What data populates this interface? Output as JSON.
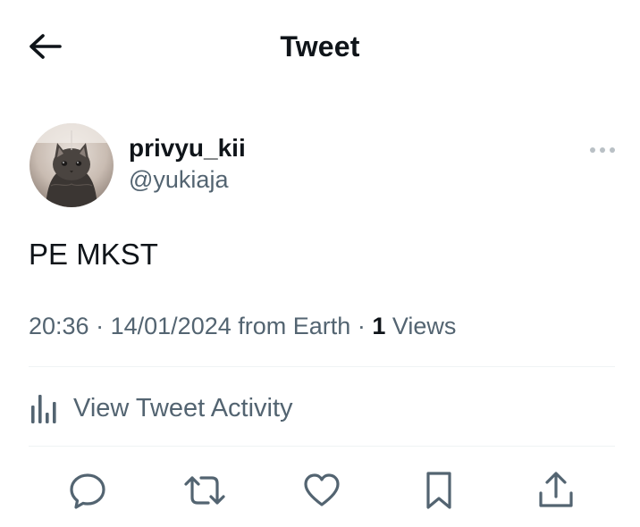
{
  "header": {
    "title": "Tweet",
    "back_icon": "arrow-left-icon"
  },
  "tweet": {
    "author": {
      "display_name": "privyu_kii",
      "handle": "@yukiaja",
      "avatar": "cat-avatar"
    },
    "more_icon": "more-horizontal-icon",
    "text": "PE MKST",
    "time": "20:36",
    "separator": "·",
    "date": "14/01/2024",
    "source": "from Earth",
    "views_count": "1",
    "views_label": "Views"
  },
  "activity": {
    "label": "View Tweet Activity",
    "icon": "bar-chart-icon"
  },
  "actions": [
    {
      "name": "reply",
      "icon": "reply-icon"
    },
    {
      "name": "retweet",
      "icon": "retweet-icon"
    },
    {
      "name": "like",
      "icon": "heart-icon"
    },
    {
      "name": "bookmark",
      "icon": "bookmark-icon"
    },
    {
      "name": "share",
      "icon": "share-icon"
    }
  ],
  "colors": {
    "text_primary": "#0f1419",
    "text_secondary": "#536471",
    "divider": "#eff3f4"
  }
}
